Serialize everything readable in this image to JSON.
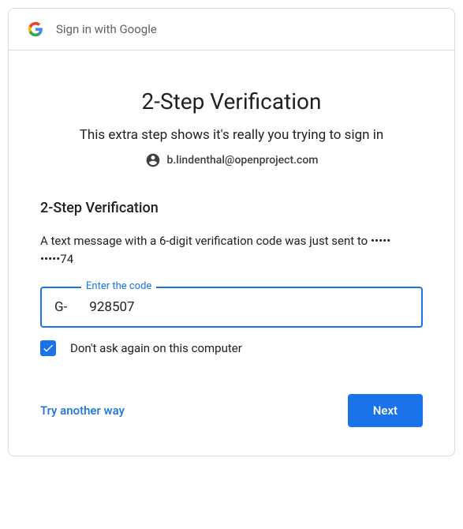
{
  "header": {
    "title": "Sign in with Google"
  },
  "main": {
    "title": "2-Step Verification",
    "subtitle": "This extra step shows it's really you trying to sign in",
    "account_email": "b.lindenthal@openproject.com",
    "section_heading": "2-Step Verification",
    "description": "A text message with a 6-digit verification code was just sent to ••••• •••••74",
    "code_label": "Enter the code",
    "code_prefix": "G-",
    "code_value": "928507",
    "checkbox_label": "Don't ask again on this computer",
    "checkbox_checked": true,
    "try_another_label": "Try another way",
    "next_label": "Next"
  }
}
